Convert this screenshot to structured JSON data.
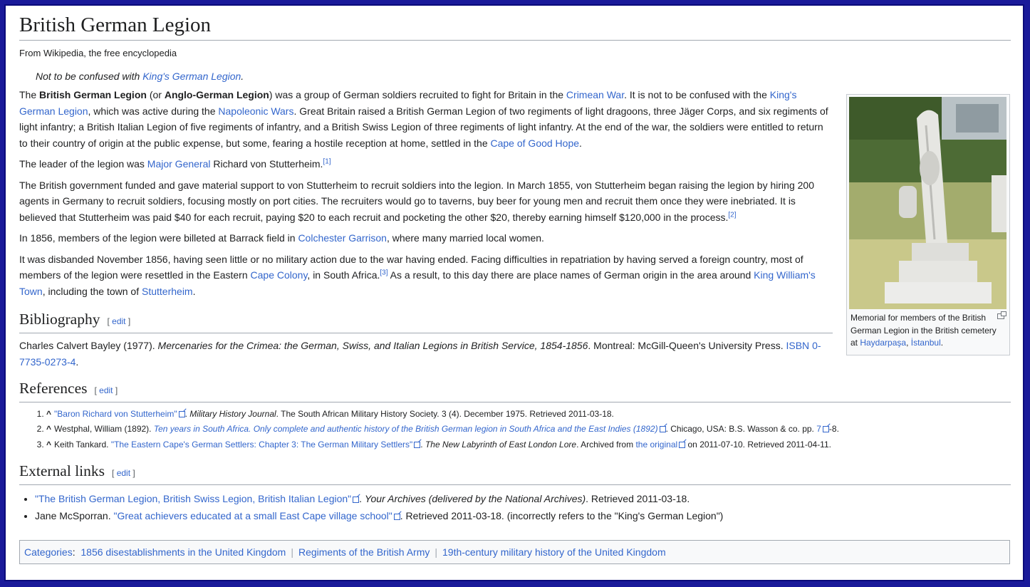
{
  "title": "British German Legion",
  "tagline": "From Wikipedia, the free encyclopedia",
  "hatnote": {
    "prefix": "Not to be confused with ",
    "link": "King's German Legion",
    "suffix": "."
  },
  "intro": {
    "p1": {
      "t1": "The ",
      "b1": "British German Legion",
      "t2": " (or ",
      "b2": "Anglo-German Legion",
      "t3": ") was a group of German soldiers recruited to fight for Britain in the ",
      "l1": "Crimean War",
      "t4": ". It is not to be confused with the ",
      "l2": "King's German Legion",
      "t5": ", which was active during the ",
      "l3": "Napoleonic Wars",
      "t6": ". Great Britain raised a British German Legion of two regiments of light dragoons, three Jäger Corps, and six regiments of light infantry; a British Italian Legion of five regiments of infantry, and a British Swiss Legion of three regiments of light infantry. At the end of the war, the soldiers were entitled to return to their country of origin at the public expense, but some, fearing a hostile reception at home, settled in the ",
      "l4": "Cape of Good Hope",
      "t7": "."
    },
    "p2": {
      "t1": "The leader of the legion was ",
      "l1": "Major General",
      "t2": " Richard von Stutterheim.",
      "ref": "[1]"
    },
    "p3": {
      "t1": "The British government funded and gave material support to von Stutterheim to recruit soldiers into the legion. In March 1855, von Stutterheim began raising the legion by hiring 200 agents in Germany to recruit soldiers, focusing mostly on port cities. The recruiters would go to taverns, buy beer for young men and recruit them once they were inebriated. It is believed that Stutterheim was paid $40 for each recruit, paying $20 to each recruit and pocketing the other $20, thereby earning himself $120,000 in the process.",
      "ref": "[2]"
    },
    "p4": {
      "t1": "In 1856, members of the legion were billeted at Barrack field in ",
      "l1": "Colchester Garrison",
      "t2": ", where many married local women."
    },
    "p5": {
      "t1": "It was disbanded November 1856, having seen little or no military action due to the war having ended. Facing difficulties in repatriation by having served a foreign country, most of members of the legion were resettled in the Eastern ",
      "l1": "Cape Colony",
      "t2": ", in South Africa.",
      "ref": "[3]",
      "t3": " As a result, to this day there are place names of German origin in the area around ",
      "l2": "King William's Town",
      "t4": ", including the town of ",
      "l3": "Stutterheim",
      "t5": "."
    }
  },
  "thumb": {
    "caption_text": "Memorial for members of the British German Legion in the British cemetery at ",
    "link1": "Haydarpaşa",
    "sep": ", ",
    "link2": "İstanbul",
    "end": "."
  },
  "bibliography": {
    "heading": "Bibliography",
    "edit": "edit",
    "t1": "Charles Calvert Bayley (1977). ",
    "i1": "Mercenaries for the Crimea: the German, Swiss, and Italian Legions in British Service, 1854-1856",
    "t2": ". Montreal: McGill-Queen's University Press. ",
    "l1": "ISBN",
    "t3": " ",
    "l2": "0-7735-0273-4",
    "t4": "."
  },
  "references": {
    "heading": "References",
    "edit": "edit",
    "items": [
      {
        "l1": "\"Baron Richard von Stutterheim\"",
        "t1": ". ",
        "i1": "Military History Journal",
        "t2": ". The South African Military History Society. 3 (4). December 1975. Retrieved 2011-03-18."
      },
      {
        "t0": "Westphal, William (1892). ",
        "l1": "Ten years in South Africa. Only complete and authentic history of the British German legion in South Africa and the East Indies (1892)",
        "t1": ". Chicago, USA: B.S. Wasson & co. pp. ",
        "l2": "7",
        "t2": "-8."
      },
      {
        "t0": "Keith Tankard. ",
        "l1": "\"The Eastern Cape's German Settlers: Chapter 3: The German Military Settlers\"",
        "t1": ". ",
        "i1": "The New Labyrinth of East London Lore",
        "t2": ". Archived from ",
        "l2": "the original",
        "t3": " on 2011-07-10. Retrieved 2011-04-11."
      }
    ]
  },
  "external": {
    "heading": "External links",
    "edit": "edit",
    "items": [
      {
        "t0": "",
        "l1": "\"The British German Legion, British Swiss Legion, British Italian Legion\"",
        "t1": ". ",
        "i1": "Your Archives (delivered by the National Archives)",
        "t2": ". Retrieved 2011-03-18."
      },
      {
        "t0": "Jane McSporran. ",
        "l1": "\"Great achievers educated at a small East Cape village school\"",
        "t1": ". Retrieved 2011-03-18. (incorrectly refers to the \"King's German Legion\")",
        "i1": "",
        "t2": ""
      }
    ]
  },
  "categories": {
    "label": "Categories",
    "colon": ":",
    "items": [
      "1856 disestablishments in the United Kingdom",
      "Regiments of the British Army",
      "19th-century military history of the United Kingdom"
    ]
  }
}
